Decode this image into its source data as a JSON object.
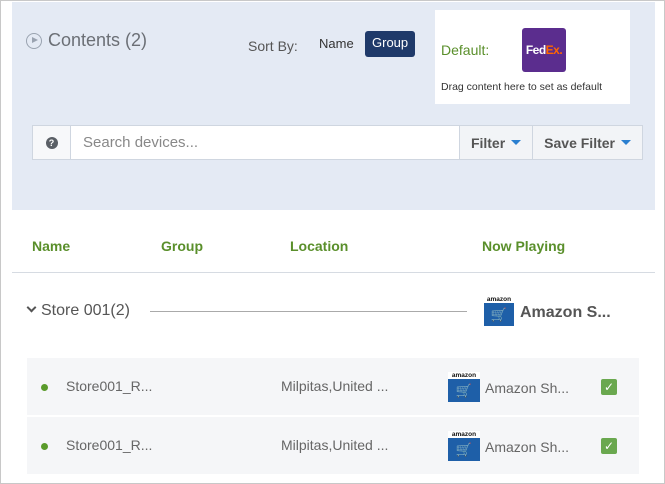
{
  "header": {
    "contents_label": "Contents (2)",
    "sort_by_label": "Sort By:",
    "sort_options": [
      {
        "label": "Name",
        "active": false
      },
      {
        "label": "Group",
        "active": true
      }
    ]
  },
  "default_content": {
    "label": "Default:",
    "thumbnail_fed": "Fed",
    "thumbnail_ex": "Ex.",
    "hint": "Drag content here to set as default"
  },
  "search": {
    "help_glyph": "?",
    "placeholder": "Search devices...",
    "value": "",
    "filter_label": "Filter",
    "save_filter_label": "Save Filter"
  },
  "table": {
    "columns": [
      "Name",
      "Group",
      "Location",
      "Now Playing"
    ]
  },
  "group": {
    "label": "Store 001(2)",
    "now_playing": "Amazon S...",
    "amazon_icon_text": "amazon"
  },
  "devices": [
    {
      "name": "Store001_R...",
      "location": "Milpitas,United ...",
      "now_playing": "Amazon Sh...",
      "amazon_icon_text": "amazon",
      "checked": true
    },
    {
      "name": "Store001_R...",
      "location": "Milpitas,United ...",
      "now_playing": "Amazon Sh...",
      "amazon_icon_text": "amazon",
      "checked": true
    }
  ],
  "colors": {
    "panel_bg": "#e4eaf4",
    "accent_green": "#5a8f2b",
    "active_sort_bg": "#1f3a6a",
    "fedex_purple": "#5b2d8e",
    "check_green": "#6aa84f"
  }
}
